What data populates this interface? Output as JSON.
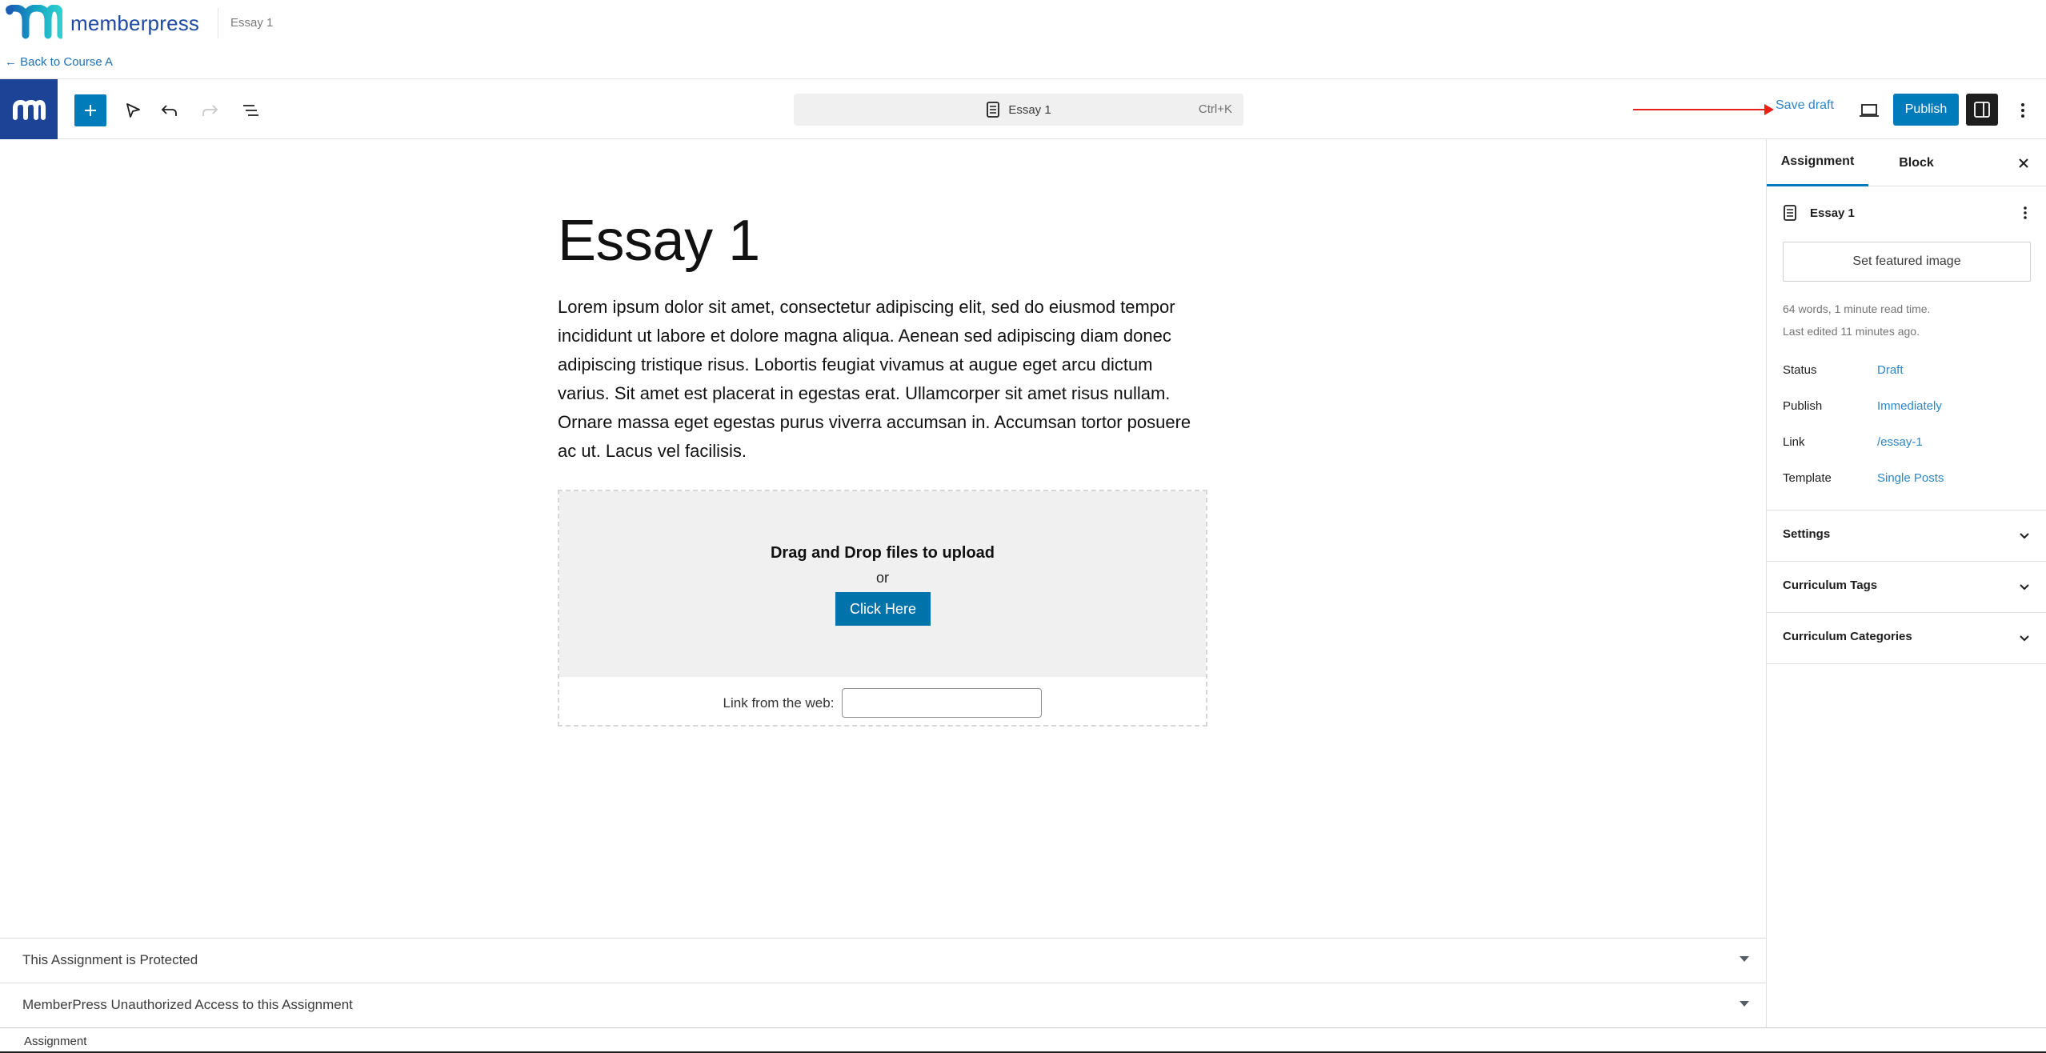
{
  "brand": {
    "name": "memberpress",
    "page_title": "Essay 1",
    "back_link": "← Back to Course A"
  },
  "toolbar": {
    "add_block": "Add block",
    "document_title": "Essay 1",
    "shortcut": "Ctrl+K",
    "save_draft": "Save draft",
    "publish": "Publish"
  },
  "post": {
    "title": "Essay 1",
    "body": "Lorem ipsum dolor sit amet, consectetur adipiscing elit, sed do eiusmod tempor incididunt ut labore et dolore magna aliqua. Aenean sed adipiscing diam donec adipiscing tristique risus. Lobortis feugiat vivamus at augue eget arcu dictum varius. Sit amet est placerat in egestas erat. Ullamcorper sit amet risus nullam. Ornare massa eget egestas purus viverra accumsan in. Accumsan tortor posuere ac ut. Lacus vel facilisis."
  },
  "upload": {
    "title": "Drag and Drop files to upload",
    "or": "or",
    "button": "Click Here",
    "web_label": "Link from the web:",
    "web_value": ""
  },
  "metaboxes": [
    {
      "title": "This Assignment is Protected"
    },
    {
      "title": "MemberPress Unauthorized Access to this Assignment"
    }
  ],
  "footer": {
    "breadcrumb": "Assignment"
  },
  "sidebar": {
    "tabs": [
      {
        "label": "Assignment",
        "active": true
      },
      {
        "label": "Block",
        "active": false
      }
    ],
    "post_title": "Essay 1",
    "featured_image": "Set featured image",
    "meta_words": "64 words, 1 minute read time.",
    "meta_edited": "Last edited 11 minutes ago.",
    "rows": [
      {
        "label": "Status",
        "value": "Draft"
      },
      {
        "label": "Publish",
        "value": "Immediately"
      },
      {
        "label": "Link",
        "value": "/essay-1"
      },
      {
        "label": "Template",
        "value": "Single Posts"
      }
    ],
    "panels": [
      {
        "title": "Settings"
      },
      {
        "title": "Curriculum Tags"
      },
      {
        "title": "Curriculum Categories"
      }
    ]
  },
  "colors": {
    "accent": "#007cba",
    "link": "#2f86c6",
    "brand_dark": "#1d4397",
    "annotation_arrow": "#e8201a"
  }
}
